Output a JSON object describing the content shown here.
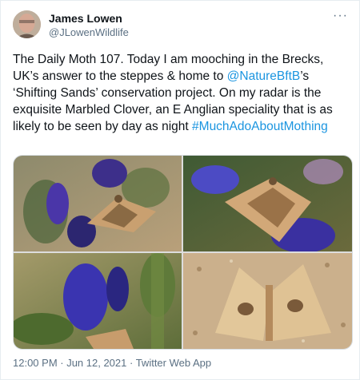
{
  "tweet": {
    "author_name": "James Lowen",
    "author_handle": "@JLowenWildlife",
    "text_parts": [
      "The Daily Moth 107. Today I am mooching in the Brecks, UK’s answer to the steppes & home to ",
      "@NatureBftB",
      "’s ‘Shifting Sands’ conservation project. On my radar is the exquisite Marbled Clover, an E Anglian speciality that is as likely to be seen by day as night ",
      "#MuchAdoAboutMothing"
    ],
    "timestamp": "12:00 PM · Jun 12, 2021 · ",
    "client": "Twitter Web App",
    "more_glyph": "···",
    "photos": [
      {
        "icon": "moth-on-viper-bugloss-photo"
      },
      {
        "icon": "moth-on-viper-bugloss-photo"
      },
      {
        "icon": "moth-on-viper-bugloss-photo"
      },
      {
        "icon": "moth-on-sand-photo"
      }
    ]
  },
  "colors": {
    "link": "#1b95e0",
    "secondary_text": "#5b7083",
    "border": "#e6ecf0"
  }
}
